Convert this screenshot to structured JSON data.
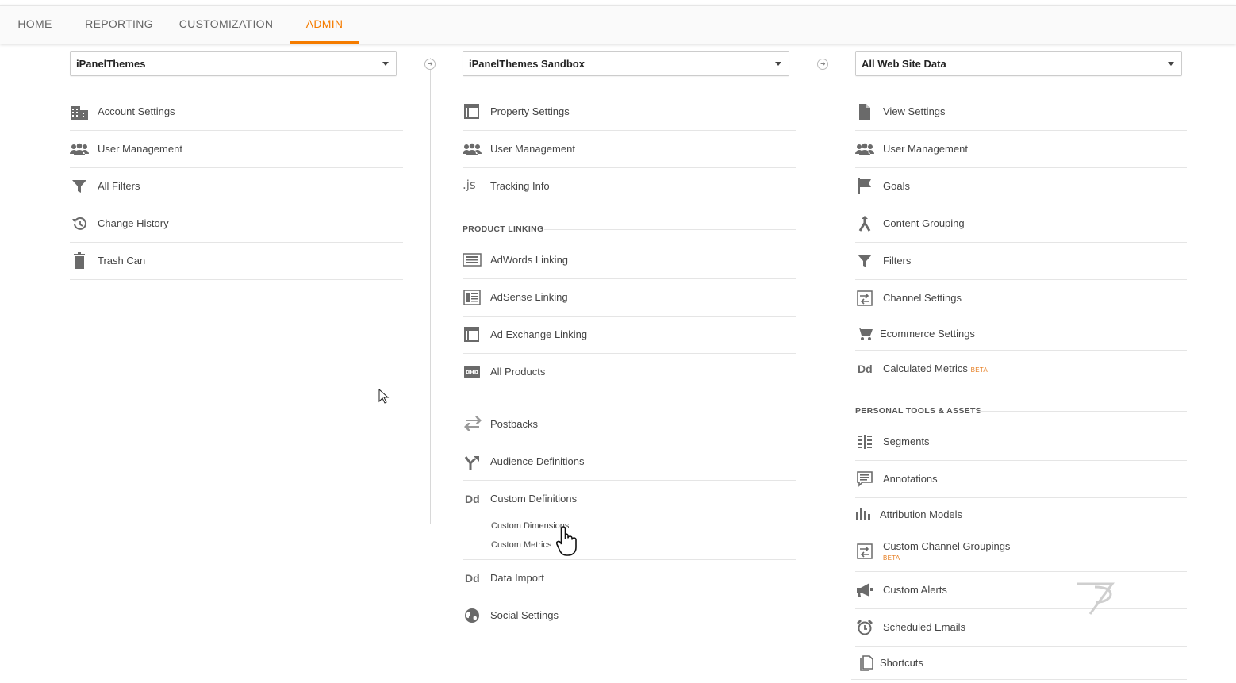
{
  "nav": {
    "tabs": [
      {
        "label": "HOME"
      },
      {
        "label": "REPORTING"
      },
      {
        "label": "CUSTOMIZATION"
      },
      {
        "label": "ADMIN",
        "active": true
      }
    ]
  },
  "accent_color": "#f57c00",
  "account": {
    "selected": "iPanelThemes",
    "items": [
      {
        "label": "Account Settings",
        "icon": "building-icon"
      },
      {
        "label": "User Management",
        "icon": "users-icon"
      },
      {
        "label": "All Filters",
        "icon": "filter-icon"
      },
      {
        "label": "Change History",
        "icon": "history-icon"
      },
      {
        "label": "Trash Can",
        "icon": "trash-icon"
      }
    ]
  },
  "property": {
    "selected": "iPanelThemes Sandbox",
    "items": [
      {
        "label": "Property Settings",
        "icon": "layout-icon"
      },
      {
        "label": "User Management",
        "icon": "users-icon"
      },
      {
        "label": "Tracking Info",
        "icon": "js-icon",
        "icon_text": ".js"
      }
    ],
    "product_linking_title": "PRODUCT LINKING",
    "linking_items": [
      {
        "label": "AdWords Linking",
        "icon": "adwords-icon"
      },
      {
        "label": "AdSense Linking",
        "icon": "adsense-icon"
      },
      {
        "label": "Ad Exchange Linking",
        "icon": "adexchange-icon"
      },
      {
        "label": "All Products",
        "icon": "link-icon"
      }
    ],
    "other_items": [
      {
        "label": "Postbacks",
        "icon": "postbacks-icon"
      },
      {
        "label": "Audience Definitions",
        "icon": "audience-icon"
      },
      {
        "label": "Custom Definitions",
        "icon": "dd-icon",
        "icon_text": "Dd"
      },
      {
        "label": "Data Import",
        "icon": "dd-icon",
        "icon_text": "Dd"
      },
      {
        "label": "Social Settings",
        "icon": "globe-icon"
      }
    ],
    "custom_definitions_sub": [
      "Custom Dimensions",
      "Custom Metrics"
    ]
  },
  "view": {
    "selected": "All Web Site Data",
    "items": [
      {
        "label": "View Settings",
        "icon": "document-icon"
      },
      {
        "label": "User Management",
        "icon": "users-icon"
      },
      {
        "label": "Goals",
        "icon": "flag-icon"
      },
      {
        "label": "Content Grouping",
        "icon": "content-grouping-icon"
      },
      {
        "label": "Filters",
        "icon": "filter-icon"
      },
      {
        "label": "Channel Settings",
        "icon": "channel-icon"
      },
      {
        "label": "Ecommerce Settings",
        "icon": "cart-icon"
      },
      {
        "label": "Calculated Metrics",
        "icon": "dd-icon",
        "icon_text": "Dd",
        "badge": "BETA"
      }
    ],
    "personal_title": "PERSONAL TOOLS & ASSETS",
    "personal_items": [
      {
        "label": "Segments",
        "icon": "segments-icon"
      },
      {
        "label": "Annotations",
        "icon": "comment-icon"
      },
      {
        "label": "Attribution Models",
        "icon": "bar-chart-icon"
      },
      {
        "label": "Custom Channel Groupings",
        "icon": "channel-icon",
        "badge": "BETA"
      },
      {
        "label": "Custom Alerts",
        "icon": "megaphone-icon"
      },
      {
        "label": "Scheduled Emails",
        "icon": "alarm-icon"
      },
      {
        "label": "Shortcuts",
        "icon": "shortcut-icon"
      }
    ]
  }
}
